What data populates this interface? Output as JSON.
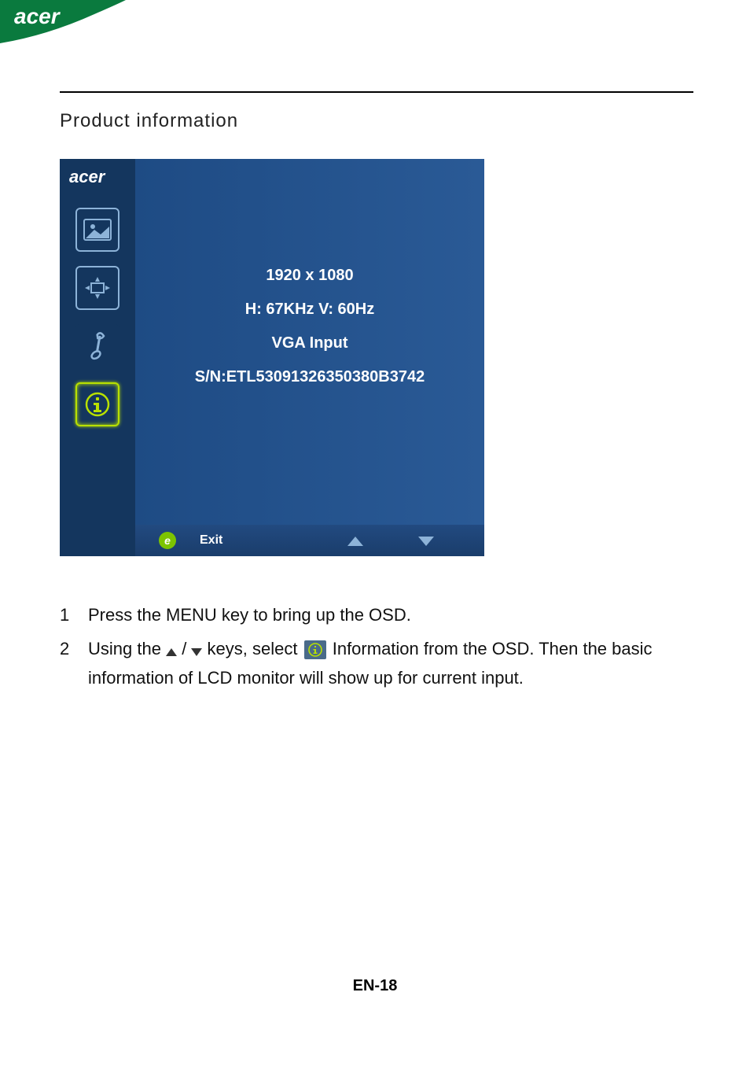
{
  "brand": "acer",
  "section_title": "Product information",
  "osd": {
    "resolution": "1920 x 1080",
    "frequency": "H: 67KHz   V: 60Hz",
    "input": "VGA Input",
    "serial": "S/N:ETL53091326350380B3742",
    "exit_label": "Exit"
  },
  "instructions": {
    "item1_num": "1",
    "item1": "Press the MENU key to bring up the OSD.",
    "item2_num": "2",
    "item2_a": "Using the ",
    "item2_b": " / ",
    "item2_c": " keys, select ",
    "item2_d": " Information from the OSD. Then the basic information of LCD monitor will show up for current input."
  },
  "page_number": "EN-18"
}
